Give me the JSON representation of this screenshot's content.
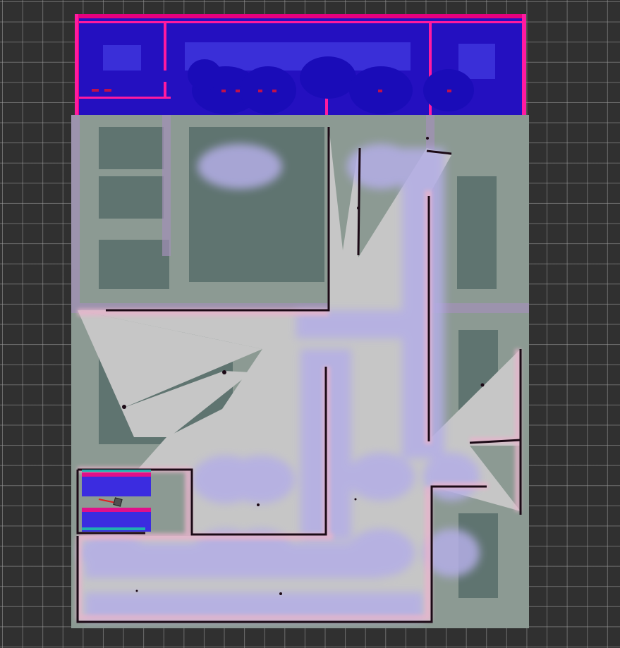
{
  "app": {
    "view": "rviz-map-display"
  },
  "colors": {
    "background": "#303030",
    "grid_line": "#8a8a8a",
    "map_free": "#c4c4c4",
    "map_unknown": "#6b7e78",
    "obstacle": "#1a0a14",
    "costmap_lethal": "#ff0090",
    "costmap_inscribed": "#d0107a",
    "costmap_inflated": "#1f10c8",
    "costmap_light": "#b6b0ea",
    "robot_heading": "#e02020",
    "robot_body": "#505050"
  },
  "layers": {
    "grid": "grid",
    "map": "occupancy-grid-map",
    "global_costmap": "global-costmap",
    "local_costmap": "local-costmap",
    "robot": "robot-footprint"
  }
}
